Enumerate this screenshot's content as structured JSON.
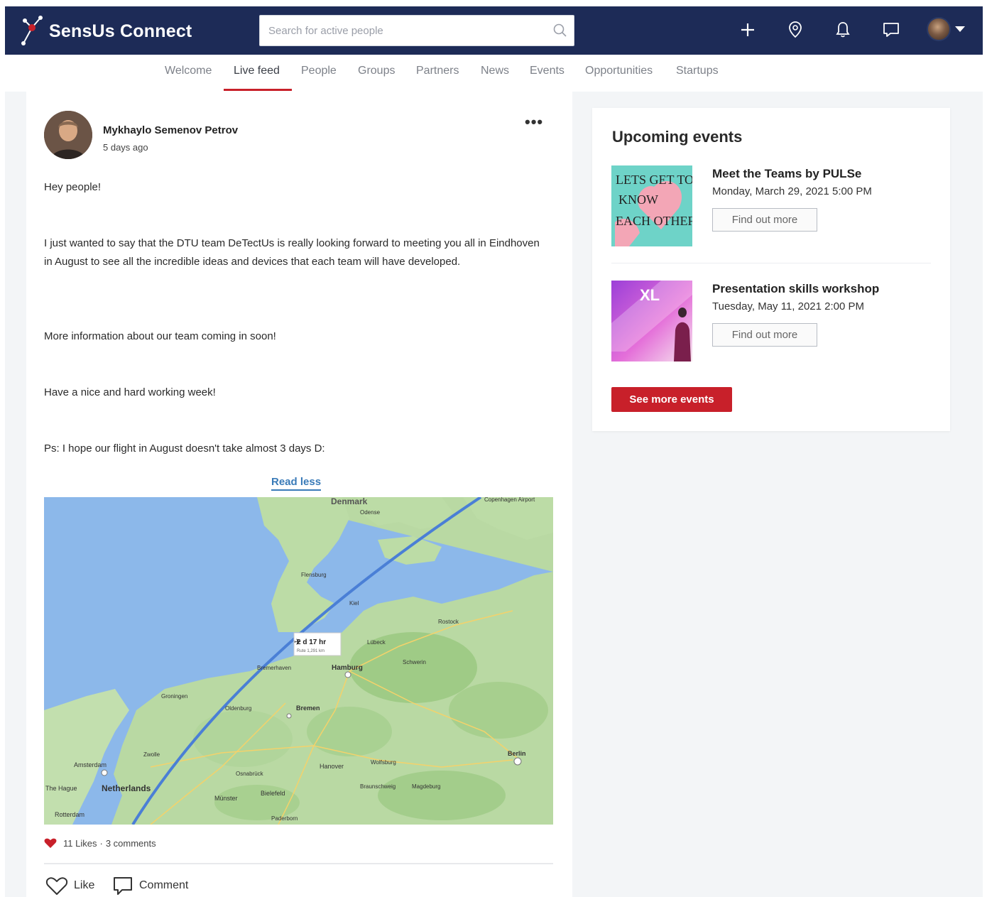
{
  "header": {
    "brand": "SensUs Connect",
    "search_placeholder": "Search for active people",
    "icons": [
      "plus-icon",
      "location-pin-icon",
      "bell-icon",
      "chat-icon",
      "avatar",
      "chevron-down-icon"
    ],
    "colors": {
      "topbar": "#1d2b57",
      "accent": "#c8202a"
    }
  },
  "nav": {
    "tabs": [
      {
        "label": "Welcome"
      },
      {
        "label": "Live feed",
        "active": true
      },
      {
        "label": "People"
      },
      {
        "label": "Groups"
      },
      {
        "label": "Partners"
      },
      {
        "label": "News"
      },
      {
        "label": "Events"
      },
      {
        "label": "Opportunities"
      },
      {
        "label": "Startups"
      }
    ]
  },
  "post": {
    "author": "Mykhaylo Semenov Petrov",
    "time": "5 days ago",
    "paragraphs": [
      "Hey people!",
      "I just wanted to say that the DTU team DeTectUs is really looking forward to meeting you all in Eindhoven in August to see all the incredible ideas and devices that each team will have developed.",
      "More information about our team coming in soon!",
      "Have a nice and hard working week!",
      "Ps: I hope our flight in August doesn't take almost 3 days D:"
    ],
    "read_less": "Read less",
    "map": {
      "labels": {
        "denmark": "Denmark",
        "netherlands": "Netherlands",
        "amsterdam": "Amsterdam",
        "the_hague": "The Hague",
        "rotterdam": "Rotterdam",
        "hamburg": "Hamburg",
        "bremen": "Bremen",
        "hanover": "Hanover",
        "berlin": "Berlin",
        "bielefeld": "Bielefeld",
        "munster": "Münster",
        "wolfsburg": "Wolfsburg",
        "magdeburg": "Magdeburg",
        "oldenburg": "Oldenburg",
        "groningen": "Groningen",
        "zwolle": "Zwolle",
        "kiel": "Kiel",
        "flensburg": "Flensburg",
        "odense": "Odense",
        "rostock": "Rostock",
        "schwerin": "Schwerin",
        "lubeck": "Lübeck",
        "bremerhaven": "Bremerhaven",
        "braunschweig": "Braunschweig",
        "osnabruck": "Osnabrück",
        "paderborn": "Paderborn",
        "copenhagen_airport": "Copenhagen Airport"
      },
      "flight_duration": "2 d 17 hr",
      "flight_distance": "Rute 1,291 km"
    },
    "likes": "11 Likes",
    "comments": "3 comments",
    "actions": {
      "like": "Like",
      "comment": "Comment"
    }
  },
  "events": {
    "title": "Upcoming events",
    "items": [
      {
        "name": "Meet the Teams by PULSe",
        "date": "Monday, March 29, 2021 5:00 PM",
        "button": "Find out more",
        "thumb_text": [
          "LETS GET TO",
          "KNOW",
          "EACH OTHER"
        ]
      },
      {
        "name": "Presentation skills workshop",
        "date": "Tuesday, May 11, 2021 2:00 PM",
        "button": "Find out more",
        "thumb_text": [
          "XL"
        ]
      }
    ],
    "see_more": "See more events"
  }
}
